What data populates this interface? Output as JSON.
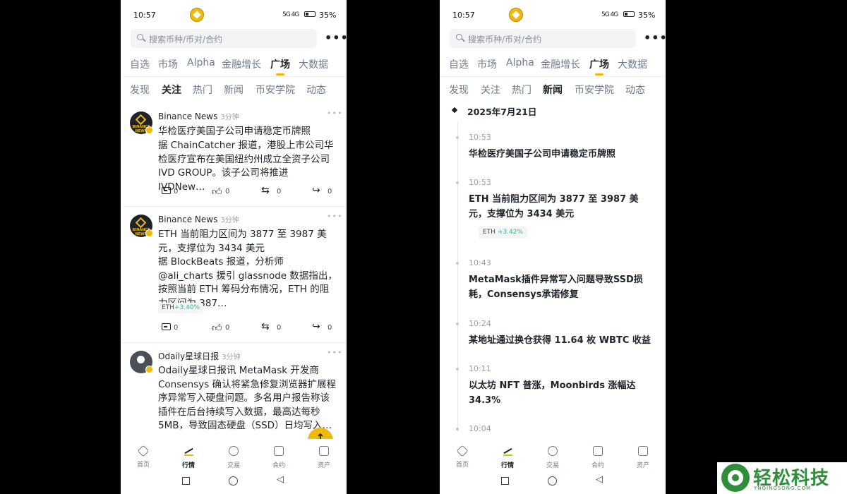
{
  "status_bar": {
    "time": "10:57",
    "signal": "5G 4G",
    "battery": "35%"
  },
  "search": {
    "placeholder": "搜索币种/币对/合约",
    "more": "•••"
  },
  "main_tabs": [
    "自选",
    "市场",
    "Alpha",
    "金融增长",
    "广场",
    "大数据"
  ],
  "main_tab_active": "广场",
  "sub_tabs": [
    "发现",
    "关注",
    "热门",
    "新闻",
    "币安学院",
    "动态"
  ],
  "left": {
    "sub_tab_active": "关注",
    "posts": [
      {
        "author": "Binance News",
        "ago": "3分钟",
        "avatar_text": "BINANCE NEWS",
        "title": "华检医疗美国子公司申请稳定币牌照",
        "body": "据 ChainCatcher 报道，港股上市公司华检医疗宣布在美国纽约州成立全资子公司 IVD GROUP。该子公司将推进 IVDNew…",
        "actions": {
          "comments": "0",
          "likes": "0",
          "reposts": "0",
          "shares": "0"
        }
      },
      {
        "author": "Binance News",
        "ago": "3分钟",
        "avatar_text": "BINANCE NEWS",
        "title": "ETH 当前阻力区间为 3877 至 3987 美元，支撑位为 3434 美元",
        "body": "据 BlockBeats 报道，分析师 @ali_charts 援引 glassnode 数据指出，按照当前 ETH 筹码分布情况，ETH 的阻力区间为 387…",
        "chip": {
          "symbol": "ETH",
          "change": "+3.40%"
        },
        "actions": {
          "comments": "0",
          "likes": "0",
          "reposts": "0",
          "shares": "0"
        }
      },
      {
        "author": "Odaily星球日报",
        "ago": "3分钟",
        "avatar_text": "",
        "body": "Odaily星球日报讯 MetaMask 开发商 Consensys 确认将紧急修复浏览器扩展程序异常写入硬盘问题。多名用户报告称该插件在后台持续写入数据，最高达每秒 5MB，导致固态硬盘（SSD）日均写入…"
      }
    ],
    "fab": "↑"
  },
  "right": {
    "sub_tab_active": "新闻",
    "date": "2025年7月21日",
    "news": [
      {
        "time": "10:53",
        "headline": "华检医疗美国子公司申请稳定币牌照"
      },
      {
        "time": "10:53",
        "headline": "ETH 当前阻力区间为 3877 至 3987 美元，支撑位为 3434 美元",
        "chip": {
          "symbol": "ETH",
          "change": "+3.42%"
        }
      },
      {
        "time": "10:43",
        "headline": "MetaMask插件异常写入问题导致SSD损耗，Consensys承诺修复"
      },
      {
        "time": "10:24",
        "headline": "某地址通过换仓获得 11.64 枚 WBTC 收益"
      },
      {
        "time": "10:11",
        "headline": "以太坊 NFT 普涨，Moonbirds 涨幅达 34.3%"
      },
      {
        "time": "10:04",
        "headline": ""
      }
    ]
  },
  "bottom_nav": [
    "首页",
    "行情",
    "交易",
    "合约",
    "资产"
  ],
  "bottom_nav_active": "行情",
  "watermark": {
    "cn": "轻松科技",
    "en": "YNQINGSONG.COM"
  },
  "colors": {
    "accent": "#f0b90b",
    "up": "#2ebd85",
    "text": "#1e2329",
    "muted": "#707a8a"
  }
}
